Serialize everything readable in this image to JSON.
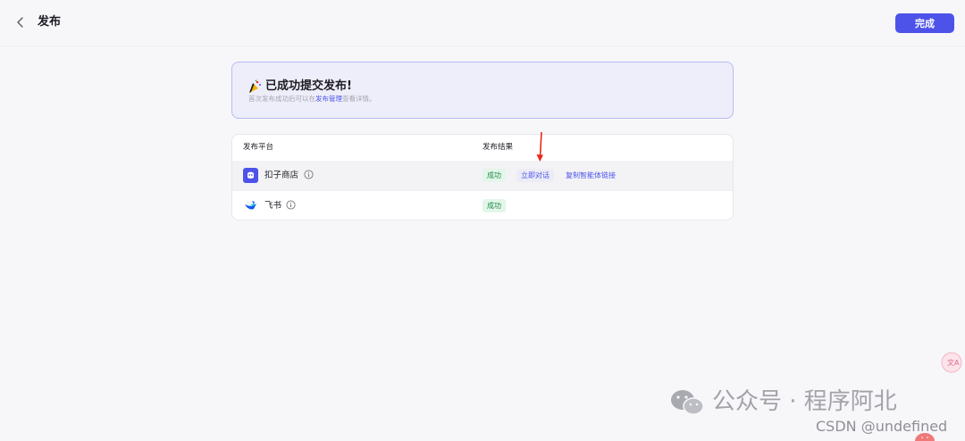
{
  "header": {
    "title": "发布",
    "done_label": "完成"
  },
  "banner": {
    "title": "已成功提交发布!",
    "sub_before": "首次发布成功后可以在",
    "sub_link": "发布管理",
    "sub_after": "查看详情。"
  },
  "table": {
    "col_platform": "发布平台",
    "col_result": "发布结果",
    "rows": [
      {
        "platform": "扣子商店",
        "status": "成功",
        "chat_label": "立即对话",
        "copy_label": "复制智能体链接"
      },
      {
        "platform": "飞书",
        "status": "成功"
      }
    ]
  },
  "watermark": {
    "text": "公众号 · 程序阿北",
    "csdn": "CSDN @undefined"
  },
  "colors": {
    "accent": "#4d53e8",
    "success": "#1f8a4d",
    "arrow": "#e8281d"
  },
  "icons": [
    "back-arrow-icon",
    "party-popper-icon",
    "coze-store-icon",
    "info-icon",
    "feishu-icon",
    "translate-icon",
    "wechat-icon"
  ]
}
